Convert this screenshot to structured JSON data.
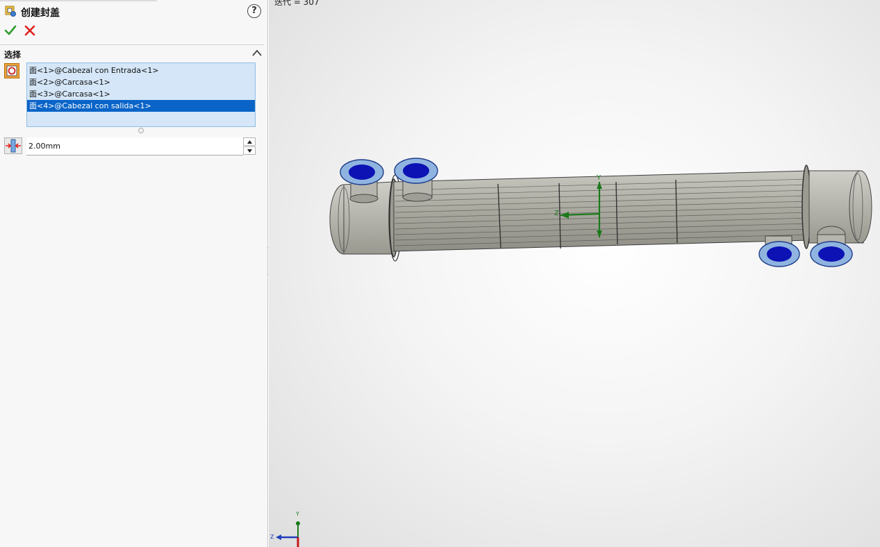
{
  "property_manager": {
    "title": "创建封盖",
    "help_label": "?",
    "ok_label": "✓",
    "cancel_label": "✕",
    "selection_section": {
      "title": "选择",
      "faces": [
        "面<1>@Cabezal con Entrada<1>",
        "面<2>@Carcasa<1>",
        "面<3>@Carcasa<1>",
        "面<4>@Cabezal con salida<1>"
      ],
      "selected_index": 3
    },
    "thickness": {
      "value": "2.00mm"
    }
  },
  "viewport": {
    "status_text": "迭代 = 307",
    "model_axes": {
      "y": "Y",
      "z": "Z"
    },
    "triad_axes": {
      "y": "Y",
      "z": "Z"
    }
  },
  "colors": {
    "accent_selected": "#0a64c8",
    "list_background": "#d4e6f7",
    "ok": "#2e9c2e",
    "cancel": "#e0201b",
    "face_highlight": "#0c12b4",
    "axis_green": "#1a7a1a"
  },
  "icons": {
    "feature": "cap-feature-icon",
    "help": "help-icon",
    "ok": "checkmark-icon",
    "cancel": "close-icon",
    "collapse": "chevron-up-icon",
    "faces": "face-selection-icon",
    "thickness": "thickness-icon"
  }
}
